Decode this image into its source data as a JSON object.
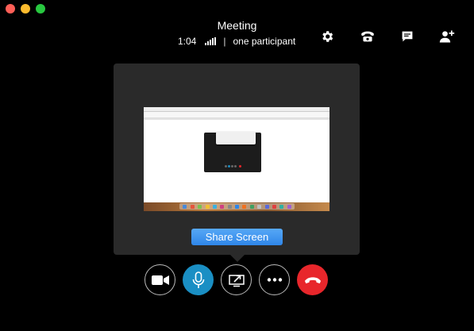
{
  "window": {
    "title": "Meeting",
    "traffic_lights": {
      "close": "#fe5f57",
      "minimize": "#febc2e",
      "maximize": "#28c840"
    }
  },
  "header": {
    "duration": "1:04",
    "separator": "|",
    "participants": "one participant"
  },
  "top_icons": [
    "gear-icon",
    "phone-icon",
    "chat-icon",
    "add-person-icon"
  ],
  "share_panel": {
    "button_label": "Share Screen",
    "accent": "#2f86e8"
  },
  "controls": [
    {
      "name": "video-button",
      "icon": "camera-icon"
    },
    {
      "name": "mic-button",
      "icon": "microphone-icon",
      "color": "#1a8fc4"
    },
    {
      "name": "share-screen-button",
      "icon": "screen-share-icon"
    },
    {
      "name": "more-button",
      "icon": "ellipsis-icon"
    },
    {
      "name": "end-call-button",
      "icon": "hang-up-icon",
      "color": "#e8262b"
    }
  ]
}
